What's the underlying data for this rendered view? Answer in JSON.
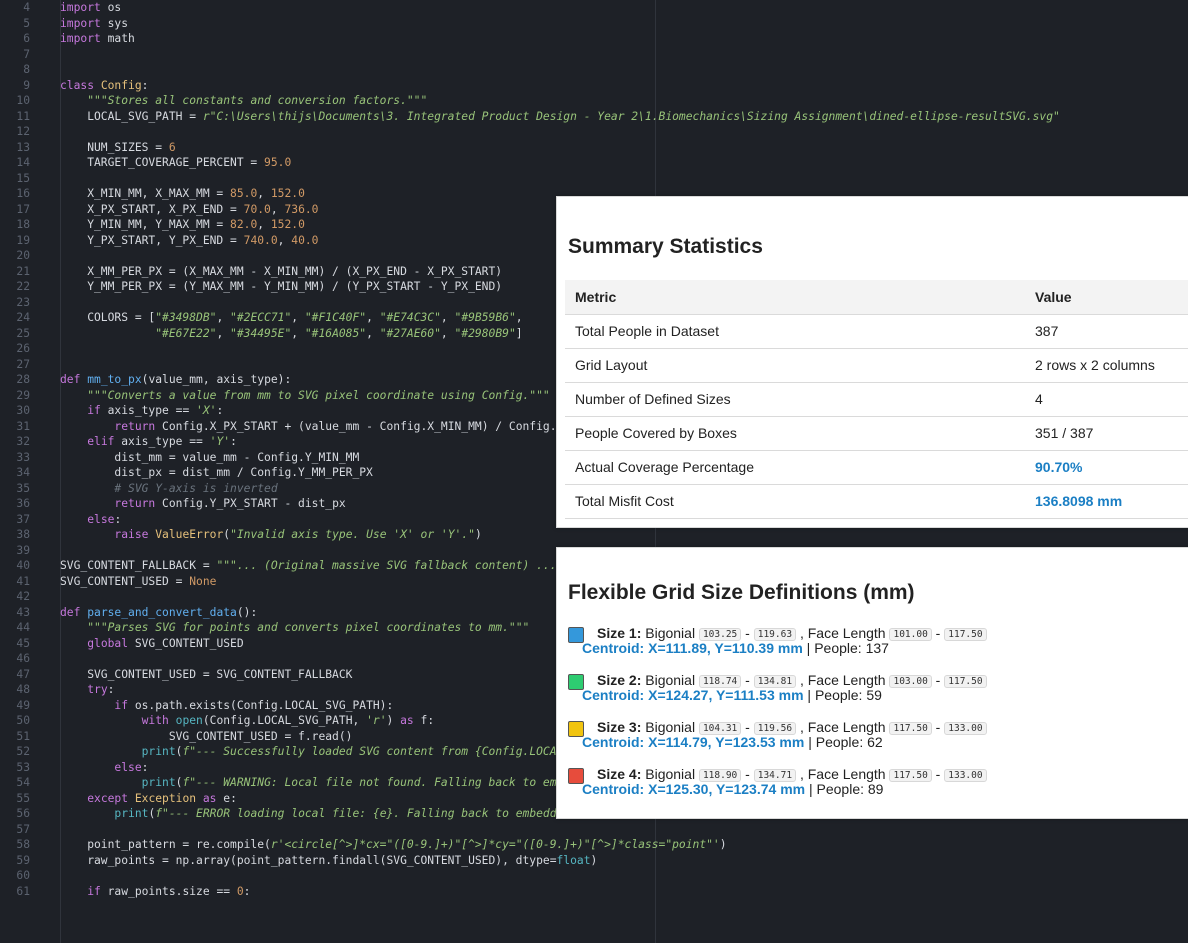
{
  "code_lines": [
    {
      "num": "4",
      "html": "<span class=\"kw\">import</span> os"
    },
    {
      "num": "5",
      "html": "<span class=\"kw\">import</span> sys"
    },
    {
      "num": "6",
      "html": "<span class=\"kw\">import</span> math"
    },
    {
      "num": "7",
      "html": ""
    },
    {
      "num": "8",
      "html": ""
    },
    {
      "num": "9",
      "html": "<span class=\"kw\">class</span> <span class=\"cls\">Config</span>:"
    },
    {
      "num": "10",
      "html": "    <span class=\"str\">\"\"\"Stores all constants and conversion factors.\"\"\"</span>"
    },
    {
      "num": "11",
      "html": "    LOCAL_SVG_PATH = <span class=\"str\">r\"C:\\Users\\thijs\\Documents\\3. Integrated Product Design - Year 2\\1.Biomechanics\\Sizing Assignment\\dined-ellipse-resultSVG.svg\"</span>"
    },
    {
      "num": "12",
      "html": ""
    },
    {
      "num": "13",
      "html": "    NUM_SIZES = <span class=\"num\">6</span>"
    },
    {
      "num": "14",
      "html": "    TARGET_COVERAGE_PERCENT = <span class=\"num\">95.0</span>"
    },
    {
      "num": "15",
      "html": ""
    },
    {
      "num": "16",
      "html": "    X_MIN_MM, X_MAX_MM = <span class=\"num\">85.0</span>, <span class=\"num\">152.0</span>"
    },
    {
      "num": "17",
      "html": "    X_PX_START, X_PX_END = <span class=\"num\">70.0</span>, <span class=\"num\">736.0</span>"
    },
    {
      "num": "18",
      "html": "    Y_MIN_MM, Y_MAX_MM = <span class=\"num\">82.0</span>, <span class=\"num\">152.0</span>"
    },
    {
      "num": "19",
      "html": "    Y_PX_START, Y_PX_END = <span class=\"num\">740.0</span>, <span class=\"num\">40.0</span>"
    },
    {
      "num": "20",
      "html": ""
    },
    {
      "num": "21",
      "html": "    X_MM_PER_PX = (X_MAX_MM - X_MIN_MM) / (X_PX_END - X_PX_START)"
    },
    {
      "num": "22",
      "html": "    Y_MM_PER_PX = (Y_MAX_MM - Y_MIN_MM) / (Y_PX_START - Y_PX_END)"
    },
    {
      "num": "23",
      "html": ""
    },
    {
      "num": "24",
      "html": "    COLORS = [<span class=\"str\">\"#3498DB\"</span>, <span class=\"str\">\"#2ECC71\"</span>, <span class=\"str\">\"#F1C40F\"</span>, <span class=\"str\">\"#E74C3C\"</span>, <span class=\"str\">\"#9B59B6\"</span>,"
    },
    {
      "num": "25",
      "html": "              <span class=\"str\">\"#E67E22\"</span>, <span class=\"str\">\"#34495E\"</span>, <span class=\"str\">\"#16A085\"</span>, <span class=\"str\">\"#27AE60\"</span>, <span class=\"str\">\"#2980B9\"</span>]"
    },
    {
      "num": "26",
      "html": ""
    },
    {
      "num": "27",
      "html": ""
    },
    {
      "num": "28",
      "html": "<span class=\"kw\">def</span> <span class=\"fn\">mm_to_px</span>(value_mm, axis_type):"
    },
    {
      "num": "29",
      "html": "    <span class=\"str\">\"\"\"Converts a value from mm to SVG pixel coordinate using Config.\"\"\"</span>"
    },
    {
      "num": "30",
      "html": "    <span class=\"kw\">if</span> axis_type == <span class=\"str\">'X'</span>:"
    },
    {
      "num": "31",
      "html": "        <span class=\"kw\">return</span> Config.X_PX_START + (value_mm - Config.X_MIN_MM) / Config.X_MM_PER_PX"
    },
    {
      "num": "32",
      "html": "    <span class=\"kw\">elif</span> axis_type == <span class=\"str\">'Y'</span>:"
    },
    {
      "num": "33",
      "html": "        dist_mm = value_mm - Config.Y_MIN_MM"
    },
    {
      "num": "34",
      "html": "        dist_px = dist_mm / Config.Y_MM_PER_PX"
    },
    {
      "num": "35",
      "html": "        <span class=\"cmt\"># SVG Y-axis is inverted</span>"
    },
    {
      "num": "36",
      "html": "        <span class=\"kw\">return</span> Config.Y_PX_START - dist_px"
    },
    {
      "num": "37",
      "html": "    <span class=\"kw\">else</span>:"
    },
    {
      "num": "38",
      "html": "        <span class=\"kw\">raise</span> <span class=\"cls\">ValueError</span>(<span class=\"str\">\"Invalid axis type. Use 'X' or 'Y'.\"</span>)"
    },
    {
      "num": "39",
      "html": ""
    },
    {
      "num": "40",
      "html": "SVG_CONTENT_FALLBACK = <span class=\"str\">\"\"\"... (Original massive SVG fallback content) ...\"\"\"</span>"
    },
    {
      "num": "41",
      "html": "SVG_CONTENT_USED = <span class=\"num\">None</span>"
    },
    {
      "num": "42",
      "html": ""
    },
    {
      "num": "43",
      "html": "<span class=\"kw\">def</span> <span class=\"fn\">parse_and_convert_data</span>():"
    },
    {
      "num": "44",
      "html": "    <span class=\"str\">\"\"\"Parses SVG for points and converts pixel coordinates to mm.\"\"\"</span>"
    },
    {
      "num": "45",
      "html": "    <span class=\"kw\">global</span> SVG_CONTENT_USED"
    },
    {
      "num": "46",
      "html": ""
    },
    {
      "num": "47",
      "html": "    SVG_CONTENT_USED = SVG_CONTENT_FALLBACK"
    },
    {
      "num": "48",
      "html": "    <span class=\"kw\">try</span>:"
    },
    {
      "num": "49",
      "html": "        <span class=\"kw\">if</span> os.path.exists(Config.LOCAL_SVG_PATH):"
    },
    {
      "num": "50",
      "html": "            <span class=\"kw\">with</span> <span class=\"bi\">open</span>(Config.LOCAL_SVG_PATH, <span class=\"str\">'r'</span>) <span class=\"kw\">as</span> f:"
    },
    {
      "num": "51",
      "html": "                SVG_CONTENT_USED = f.read()"
    },
    {
      "num": "52",
      "html": "            <span class=\"bi\">print</span>(<span class=\"str\">f\"--- Successfully loaded SVG content from {Config.LOCAL_SVG_PATH} ---\"</span>)"
    },
    {
      "num": "53",
      "html": "        <span class=\"kw\">else</span>:"
    },
    {
      "num": "54",
      "html": "            <span class=\"bi\">print</span>(<span class=\"str\">f\"--- WARNING: Local file not found. Falling back to embedded data. ---\"</span>)"
    },
    {
      "num": "55",
      "html": "    <span class=\"kw\">except</span> <span class=\"cls\">Exception</span> <span class=\"kw\">as</span> e:"
    },
    {
      "num": "56",
      "html": "        <span class=\"bi\">print</span>(<span class=\"str\">f\"--- ERROR loading local file: {e}. Falling back to embedded data. ---\"</span>)"
    },
    {
      "num": "57",
      "html": ""
    },
    {
      "num": "58",
      "html": "    point_pattern = re.compile(<span class=\"str\">r'&lt;circle[^&gt;]*cx=\"([0-9.]+)\"[^&gt;]*cy=\"([0-9.]+)\"[^&gt;]*class=\"point\"'</span>)"
    },
    {
      "num": "59",
      "html": "    raw_points = np.array(point_pattern.findall(SVG_CONTENT_USED), dtype=<span class=\"bi\">float</span>)"
    },
    {
      "num": "60",
      "html": ""
    },
    {
      "num": "61",
      "html": "    <span class=\"kw\">if</span> raw_points.size == <span class=\"num\">0</span>:"
    }
  ],
  "summary": {
    "title": "Summary Statistics",
    "headers": {
      "metric": "Metric",
      "value": "Value"
    },
    "rows": [
      {
        "metric": "Total People in Dataset",
        "value": "387",
        "highlight": false
      },
      {
        "metric": "Grid Layout",
        "value": "2 rows x 2 columns",
        "highlight": false
      },
      {
        "metric": "Number of Defined Sizes",
        "value": "4",
        "highlight": false
      },
      {
        "metric": "People Covered by Boxes",
        "value": "351 / 387",
        "highlight": false
      },
      {
        "metric": "Actual Coverage Percentage",
        "value": "90.70%",
        "highlight": true
      },
      {
        "metric": "Total Misfit Cost",
        "value": "136.8098 mm",
        "highlight": true
      }
    ]
  },
  "grid": {
    "title": "Flexible Grid Size Definitions (mm)",
    "sizes": [
      {
        "label": "Size 1:",
        "color": "#3498DB",
        "bigonial_label": "Bigonial",
        "bigonial_min": "103.25",
        "bigonial_max": "119.63",
        "face_label": ", Face Length",
        "face_min": "101.00",
        "face_max": "117.50",
        "centroid": "Centroid: X=111.89, Y=110.39 mm",
        "people": "| People: 137"
      },
      {
        "label": "Size 2:",
        "color": "#2ECC71",
        "bigonial_label": "Bigonial",
        "bigonial_min": "118.74",
        "bigonial_max": "134.81",
        "face_label": ", Face Length",
        "face_min": "103.00",
        "face_max": "117.50",
        "centroid": "Centroid: X=124.27, Y=111.53 mm",
        "people": "| People: 59"
      },
      {
        "label": "Size 3:",
        "color": "#F1C40F",
        "bigonial_label": "Bigonial",
        "bigonial_min": "104.31",
        "bigonial_max": "119.56",
        "face_label": ", Face Length",
        "face_min": "117.50",
        "face_max": "133.00",
        "centroid": "Centroid: X=114.79, Y=123.53 mm",
        "people": "| People: 62"
      },
      {
        "label": "Size 4:",
        "color": "#E74C3C",
        "bigonial_label": "Bigonial",
        "bigonial_min": "118.90",
        "bigonial_max": "134.71",
        "face_label": ", Face Length",
        "face_min": "117.50",
        "face_max": "133.00",
        "centroid": "Centroid: X=125.30, Y=123.74 mm",
        "people": "| People: 89"
      }
    ]
  }
}
